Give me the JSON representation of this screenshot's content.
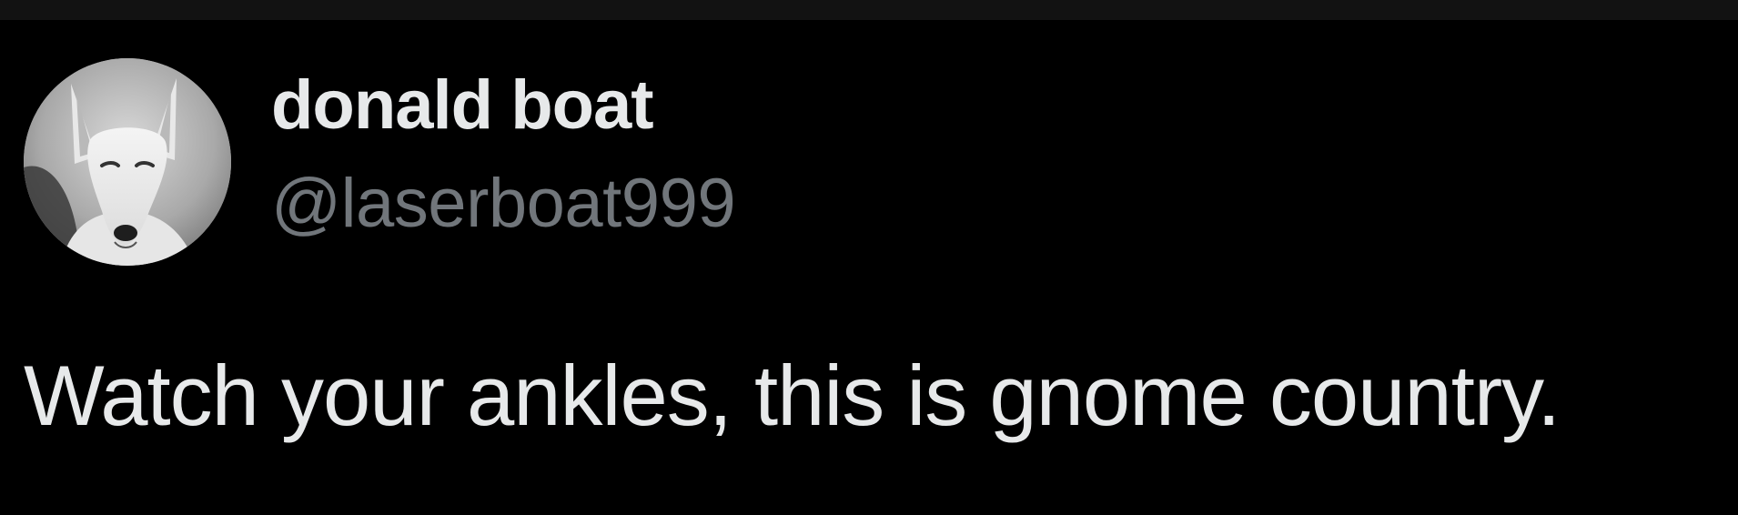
{
  "tweet": {
    "author": {
      "display_name": "donald boat",
      "handle": "@laserboat999",
      "avatar_icon": "bull-terrier-dog-avatar"
    },
    "text": "Watch your ankles, this is gnome country."
  },
  "colors": {
    "background": "#000000",
    "top_bar": "#121212",
    "primary_text": "#e7e9ea",
    "secondary_text": "#71767b"
  }
}
